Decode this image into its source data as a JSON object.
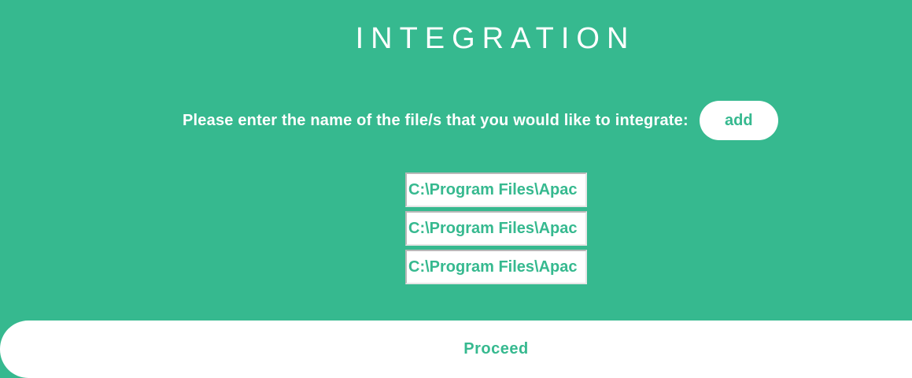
{
  "header": {
    "title": "INTEGRATION"
  },
  "prompt": {
    "label": "Please enter the name of the file/s that you would like to integrate:",
    "add_label": "add"
  },
  "files": [
    {
      "value": "C:\\Program Files\\Apac"
    },
    {
      "value": "C:\\Program Files\\Apac"
    },
    {
      "value": "C:\\Program Files\\Apac"
    }
  ],
  "footer": {
    "proceed_label": "Proceed"
  },
  "colors": {
    "background": "#36b98f",
    "foreground": "#ffffff",
    "accent_text": "#36b98f"
  }
}
